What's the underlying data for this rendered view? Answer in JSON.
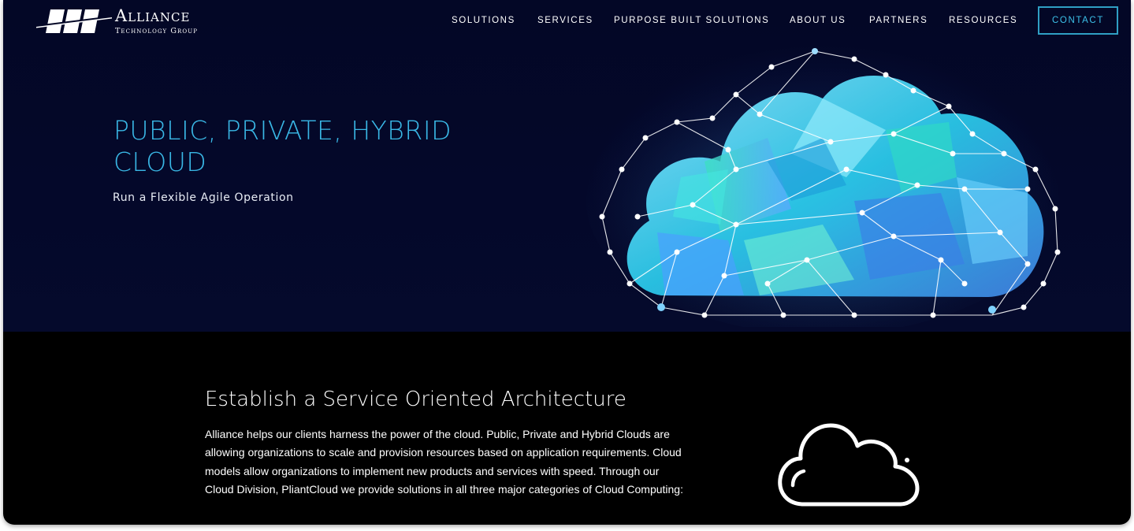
{
  "brand": {
    "name": "Alliance",
    "tagline": "Technology Group",
    "logo_icon": "alliance-logo-icon"
  },
  "nav": {
    "items": [
      {
        "label": "SOLUTIONS"
      },
      {
        "label": "SERVICES"
      },
      {
        "label": "PURPOSE BUILT SOLUTIONS"
      },
      {
        "label": "ABOUT US"
      },
      {
        "label": "PARTNERS"
      },
      {
        "label": "RESOURCES"
      }
    ],
    "contact_label": "CONTACT"
  },
  "hero": {
    "title": "PUBLIC, PRIVATE, HYBRID CLOUD",
    "subtitle": "Run a Flexible Agile Operation",
    "image_icon": "polygon-cloud-illustration"
  },
  "section": {
    "title": "Establish a Service Oriented Architecture",
    "body": "Alliance helps our clients harness the power of the cloud. Public, Private and Hybrid Clouds are allowing organizations to scale and provision resources based on application requirements. Cloud models allow organizations to implement new products and services with speed. Through our Cloud Division, PliantCloud we provide solutions in all three major categories of Cloud Computing:",
    "icon": "cloud-outline-icon"
  },
  "colors": {
    "accent": "#3ab8e6",
    "hero_bg": "#030726",
    "section_bg": "#000000",
    "contact_border": "#2f9fc4"
  }
}
